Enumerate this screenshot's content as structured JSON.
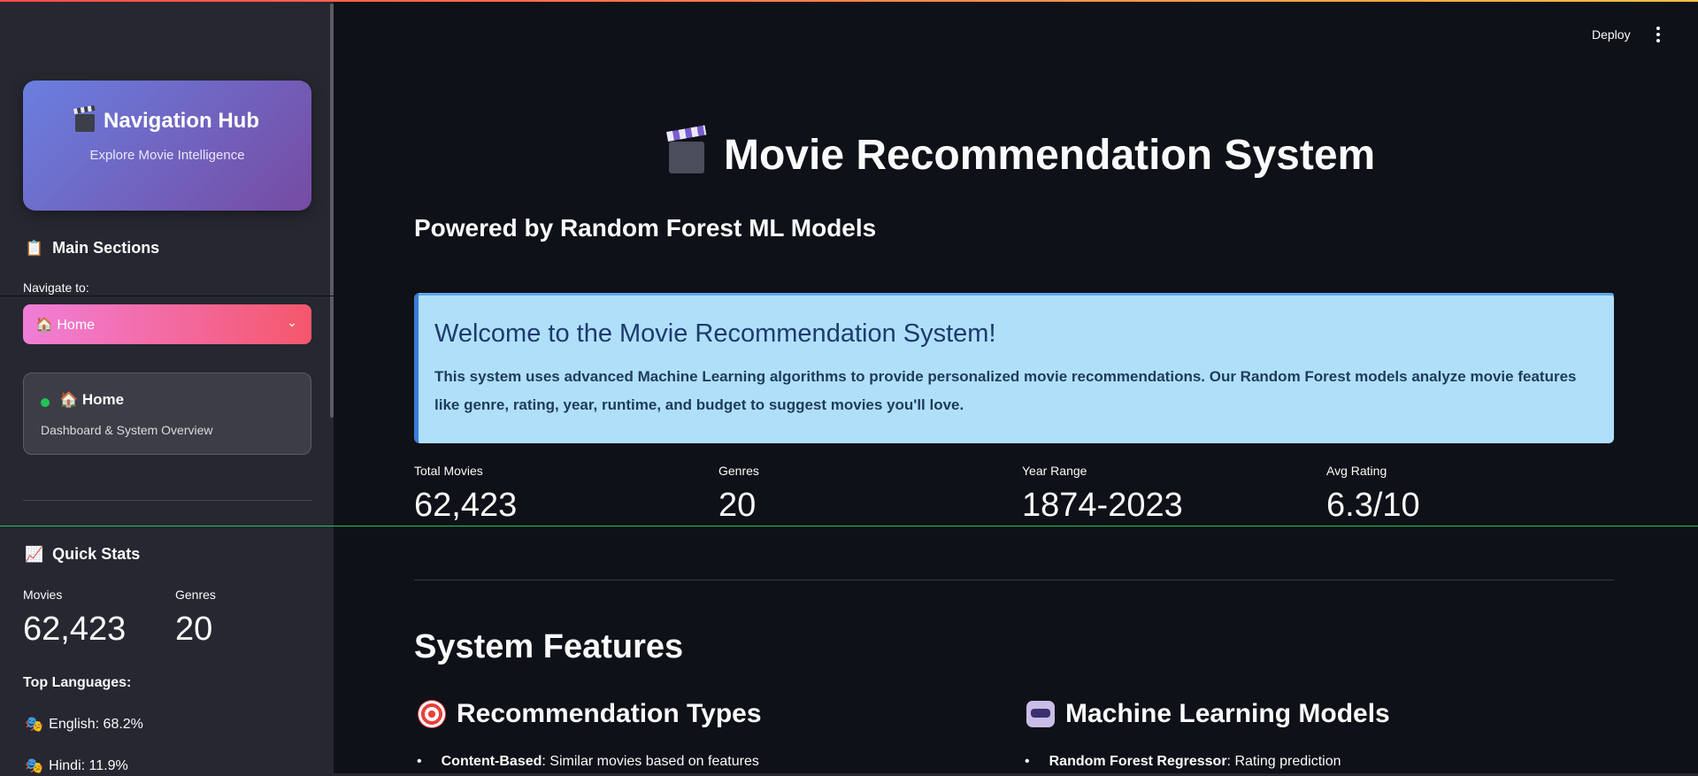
{
  "sidebar": {
    "hub_title": "Navigation Hub",
    "hub_subtitle": "Explore Movie Intelligence",
    "main_sections_title": "Main Sections",
    "navigate_label": "Navigate to:",
    "select_value": "🏠 Home",
    "current_page": {
      "title": "🏠 Home",
      "subtitle": "Dashboard & System Overview"
    },
    "quick_stats": {
      "title": "Quick Stats",
      "metrics": [
        {
          "label": "Movies",
          "value": "62,423"
        },
        {
          "label": "Genres",
          "value": "20"
        }
      ],
      "top_languages_label": "Top Languages:",
      "languages": [
        "English: 68.2%",
        "Hindi: 11.9%"
      ]
    }
  },
  "header": {
    "deploy_label": "Deploy"
  },
  "main": {
    "title": "Movie Recommendation System",
    "subtitle": "Powered by Random Forest ML Models",
    "welcome": {
      "heading": "Welcome to the Movie Recommendation System!",
      "body": "This system uses advanced Machine Learning algorithms to provide personalized movie recommendations. Our Random Forest models analyze movie features like genre, rating, year, runtime, and budget to suggest movies you'll love."
    },
    "metrics": [
      {
        "label": "Total Movies",
        "value": "62,423"
      },
      {
        "label": "Genres",
        "value": "20"
      },
      {
        "label": "Year Range",
        "value": "1874-2023"
      },
      {
        "label": "Avg Rating",
        "value": "6.3/10"
      }
    ],
    "features_title": "System Features",
    "features": [
      {
        "title": "Recommendation Types",
        "bullet_bold": "Content-Based",
        "bullet_text": ": Similar movies based on features"
      },
      {
        "title": "Machine Learning Models",
        "bullet_bold": "Random Forest Regressor",
        "bullet_text": ": Rating prediction"
      }
    ]
  },
  "colors": {
    "background": "#0e1117",
    "sidebar": "#262730",
    "hub_gradient_start": "#6a7fe0",
    "hub_gradient_end": "#764ba2",
    "select_gradient_start": "#f07ed8",
    "select_gradient_end": "#f5576c",
    "info_box": "#b0e0f9",
    "status_dot": "#21c354"
  },
  "icons": {
    "hub": "clapperboard-icon",
    "main_sections": "clipboard-icon",
    "quick_stats": "chart-increasing-icon",
    "language": "performing-arts-icon",
    "title": "clapperboard-icon",
    "recommendation": "target-icon",
    "ml": "robot-icon"
  }
}
